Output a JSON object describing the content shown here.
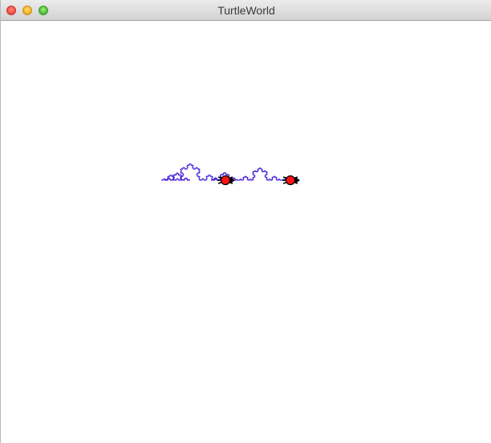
{
  "window": {
    "title": "TurtleWorld"
  },
  "canvas": {
    "fractal_name": "koch-snowflake-curve",
    "stroke_color": "#3a12d6",
    "turtle_color": "#ff1414",
    "turtle_count": 2
  }
}
